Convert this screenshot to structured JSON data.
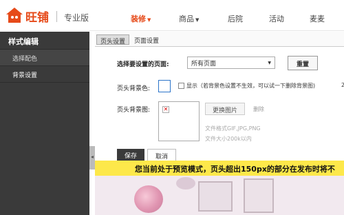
{
  "header": {
    "brand": "旺铺",
    "edition": "专业版",
    "nav": [
      {
        "label": "装修",
        "active": true,
        "dropdown": true
      },
      {
        "label": "商品",
        "active": false,
        "dropdown": true
      },
      {
        "label": "后院",
        "active": false,
        "dropdown": false
      },
      {
        "label": "活动",
        "active": false,
        "dropdown": false
      },
      {
        "label": "麦麦",
        "active": false,
        "dropdown": false
      }
    ]
  },
  "sidebar": {
    "title": "样式编辑",
    "items": [
      {
        "label": "选择配色"
      },
      {
        "label": "背景设置",
        "selected": true
      }
    ],
    "collapse_glyph": "◂"
  },
  "tabs": [
    {
      "label": "页头设置",
      "active": true
    },
    {
      "label": "页面设置",
      "active": false
    }
  ],
  "form": {
    "page_select_label": "选择要设置的页面:",
    "page_select_value": "所有页面",
    "reset_label": "重置",
    "header_bg_color_label": "页头背景色:",
    "show_checkbox_text": "显示（若背景色设置不生效，可以试一下删除背景图)",
    "right_edge_text": "2",
    "header_bg_image_label": "页头背景图:",
    "change_image_label": "更换图片",
    "delete_label": "删除",
    "format_hint": "文件格式GIF,JPG,PNG",
    "size_hint": "文件大小200k以内",
    "save_label": "保存",
    "cancel_label": "取消"
  },
  "preview": {
    "banner_text": "您当前处于预览模式，页头超出150px的部分在发布时将不"
  },
  "colors": {
    "brand": "#e64a19",
    "sidebar_bg": "#3a3a3a",
    "banner_bg": "#fde84a",
    "color_box_border": "#2b73c9"
  }
}
